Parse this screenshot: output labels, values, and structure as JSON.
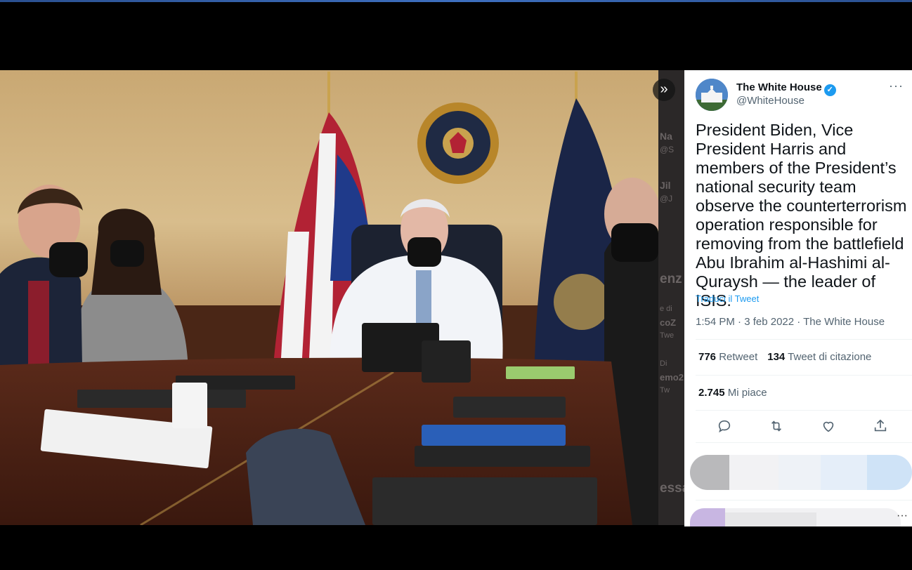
{
  "tweet": {
    "author_name": "The White House",
    "author_handle": "@WhiteHouse",
    "more_label": "···",
    "text": "President Biden, Vice President Harris and members of the President’s national security team observe the counterterrorism operation responsible for removing from the battlefield Abu Ibrahim al-Hashimi al-Quraysh — the leader of ISIS.",
    "translate_label": "Traduci il Tweet",
    "timestamp": "1:54 PM · 3 feb 2022 · The White House",
    "retweets_count": "776",
    "retweets_label": "Retweet",
    "quotes_count": "134",
    "quotes_label": "Tweet di citazione",
    "likes_count": "2.745",
    "likes_label": "Mi piace",
    "actions": [
      "reply-icon",
      "retweet-icon",
      "like-icon",
      "share-icon"
    ]
  },
  "background_timeline": [
    "Na",
    "@S",
    "Jil",
    "@J",
    "enz",
    "e di",
    "coZ",
    "Twe",
    "Di",
    "emo2",
    "Tw",
    "essa"
  ],
  "colors": {
    "accent": "#1d9bf0",
    "text": "#0f1419",
    "muted": "#536471",
    "backdrop": "#000000"
  }
}
